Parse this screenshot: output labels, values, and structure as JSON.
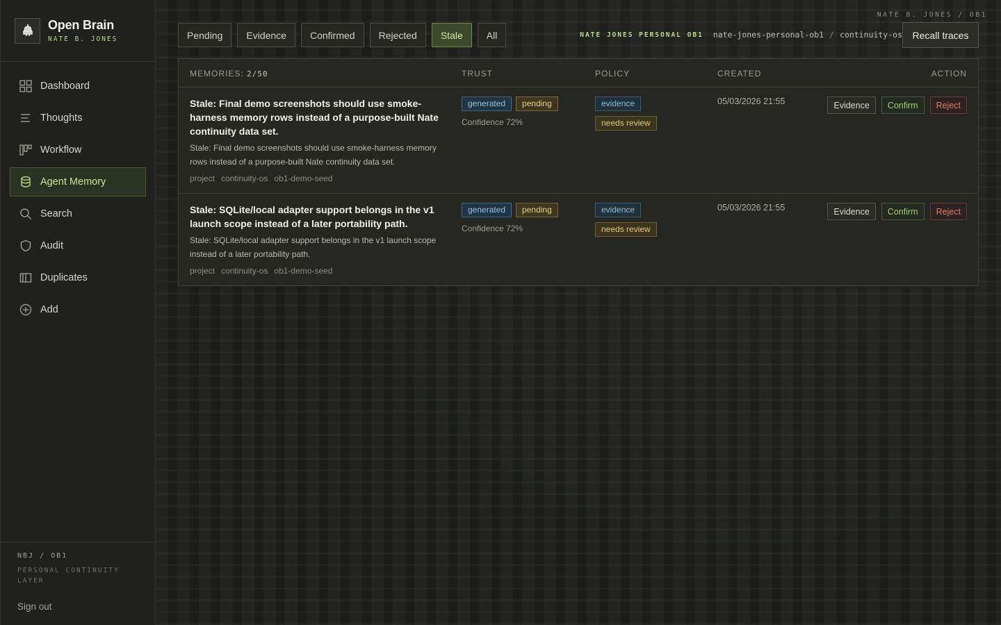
{
  "app": {
    "name": "Open Brain",
    "owner": "NATE B. JONES"
  },
  "sidebar": {
    "items": [
      {
        "label": "Dashboard",
        "icon": "grid-icon"
      },
      {
        "label": "Thoughts",
        "icon": "list-icon"
      },
      {
        "label": "Workflow",
        "icon": "columns-icon"
      },
      {
        "label": "Agent Memory",
        "icon": "database-icon",
        "active": true
      },
      {
        "label": "Search",
        "icon": "search-icon"
      },
      {
        "label": "Audit",
        "icon": "shield-icon"
      },
      {
        "label": "Duplicates",
        "icon": "book-icon"
      },
      {
        "label": "Add",
        "icon": "plus-circle-icon"
      }
    ],
    "footer": {
      "code": "NBJ / OB1",
      "desc": "PERSONAL CONTINUITY LAYER",
      "signout": "Sign out"
    }
  },
  "filters": {
    "tabs": [
      "Pending",
      "Evidence",
      "Confirmed",
      "Rejected",
      "Stale",
      "All"
    ],
    "active": "Stale"
  },
  "header": {
    "user_id": "NATE B. JONES / OB1",
    "scope_tag": "NATE JONES PERSONAL OB1",
    "scope_path_1": "nate-jones-personal-ob1",
    "scope_sep": "/",
    "scope_path_2": "continuity-os",
    "recall_label": "Recall traces"
  },
  "table": {
    "memories_label": "MEMORIES:",
    "memories_count": "2/50",
    "columns": {
      "trust": "TRUST",
      "policy": "POLICY",
      "created": "CREATED",
      "action": "ACTION"
    },
    "rows": [
      {
        "title": "Stale: Final demo screenshots should use smoke-harness memory rows instead of a purpose-built Nate continuity data set.",
        "desc": "Stale: Final demo screenshots should use smoke-harness memory rows instead of a purpose-built Nate continuity data set.",
        "tags": [
          "project",
          "continuity-os",
          "ob1-demo-seed"
        ],
        "trust_badges": [
          "generated",
          "pending"
        ],
        "confidence": "Confidence 72%",
        "policy_badges": [
          "evidence",
          "needs review"
        ],
        "created": "05/03/2026 21:55",
        "actions": {
          "evidence": "Evidence",
          "confirm": "Confirm",
          "reject": "Reject"
        }
      },
      {
        "title": "Stale: SQLite/local adapter support belongs in the v1 launch scope instead of a later portability path.",
        "desc": "Stale: SQLite/local adapter support belongs in the v1 launch scope instead of a later portability path.",
        "tags": [
          "project",
          "continuity-os",
          "ob1-demo-seed"
        ],
        "trust_badges": [
          "generated",
          "pending"
        ],
        "confidence": "Confidence 72%",
        "policy_badges": [
          "evidence",
          "needs review"
        ],
        "created": "05/03/2026 21:55",
        "actions": {
          "evidence": "Evidence",
          "confirm": "Confirm",
          "reject": "Reject"
        }
      }
    ]
  },
  "colors": {
    "accent": "#b5d98a",
    "active_nav_bg": "#2a3322",
    "confirm": "#9ed06a",
    "reject": "#e27a68"
  }
}
